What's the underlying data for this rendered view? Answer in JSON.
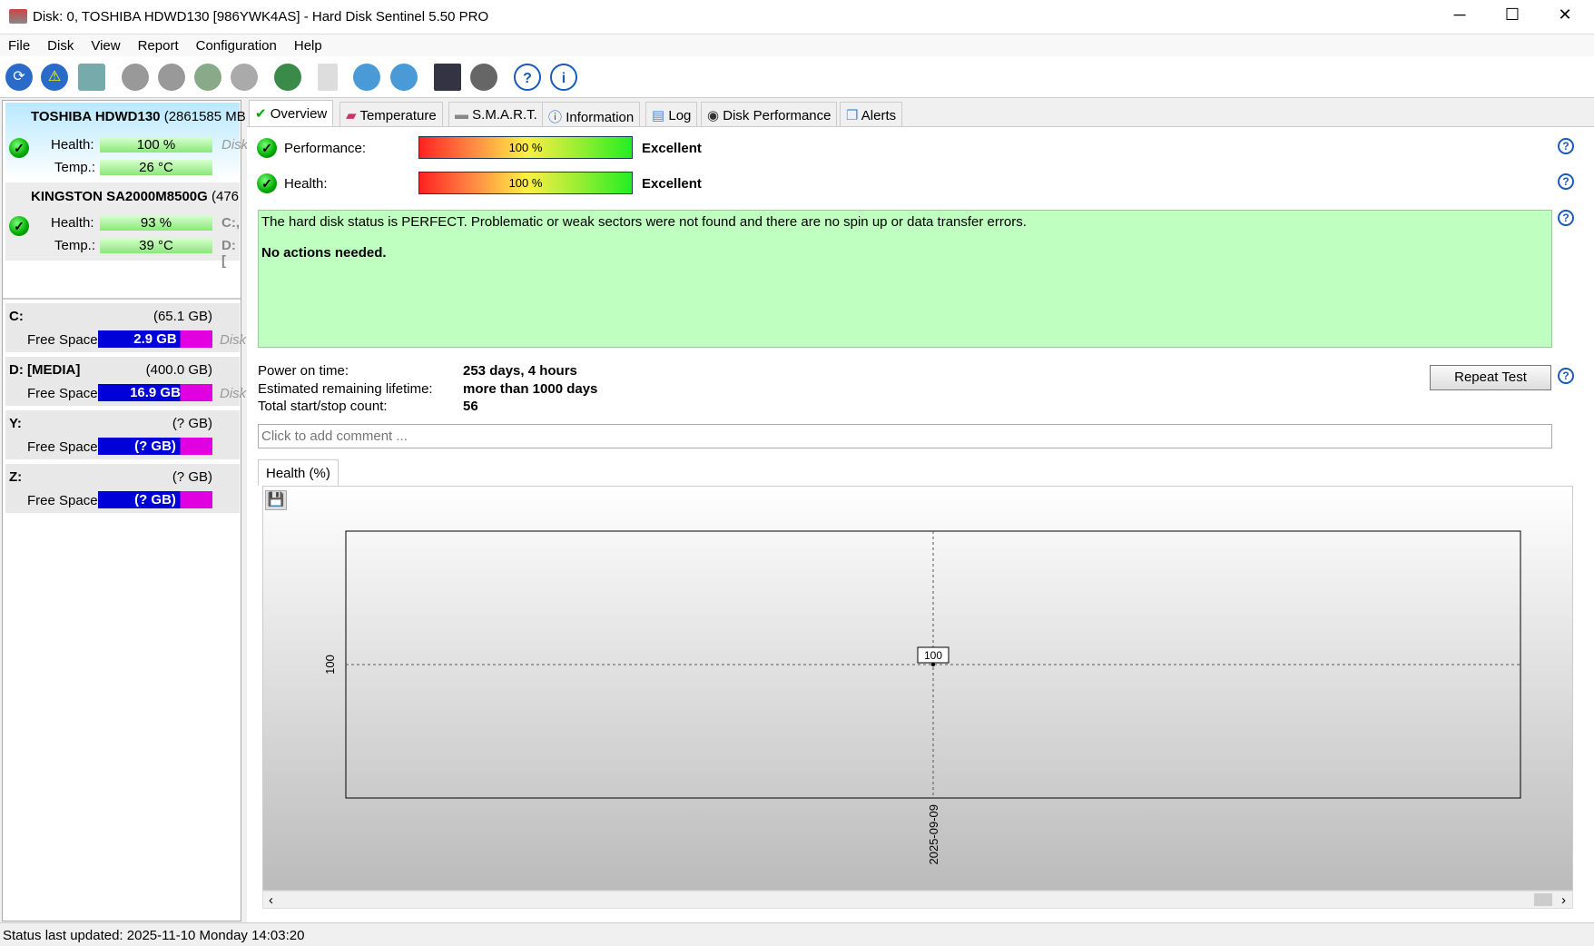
{
  "window": {
    "title": "Disk: 0, TOSHIBA HDWD130 [986YWK4AS]  -  Hard Disk Sentinel 5.50 PRO",
    "minimize": "─",
    "maximize": "☐",
    "close": "✕"
  },
  "menu": [
    "File",
    "Disk",
    "View",
    "Report",
    "Configuration",
    "Help"
  ],
  "toolbar": [
    "refresh-icon",
    "alert-icon",
    "disk-icon",
    "disk-tool-1-icon",
    "disk-tool-2-icon",
    "disk-check-icon",
    "disk-search-icon",
    "globe-icon",
    "report-icon",
    "sync-icon",
    "network-icon",
    "monitor-icon",
    "settings-icon",
    "help-icon",
    "info-icon"
  ],
  "disks": [
    {
      "name": "TOSHIBA HDWD130",
      "size": "(2861585 MB",
      "health_label": "Health:",
      "health": "100 %",
      "temp_label": "Temp.:",
      "temp": "26 °C",
      "side1": "Disk",
      "side2": ""
    },
    {
      "name": "KINGSTON SA2000M8500G",
      "size": "(476",
      "health_label": "Health:",
      "health": "93 %",
      "temp_label": "Temp.:",
      "temp": "39 °C",
      "side1": "C:,",
      "side2": "D: ["
    }
  ],
  "volumes": [
    {
      "letter": "C:",
      "size": "(65.1 GB)",
      "free_label": "Free Space",
      "free": "2.9 GB",
      "side": "Disk"
    },
    {
      "letter": "D: [MEDIA]",
      "size": "(400.0 GB)",
      "free_label": "Free Space",
      "free": "16.9 GB",
      "side": "Disk"
    },
    {
      "letter": "Y:",
      "size": "(? GB)",
      "free_label": "Free Space",
      "free": "(? GB)",
      "side": ""
    },
    {
      "letter": "Z:",
      "size": "(? GB)",
      "free_label": "Free Space",
      "free": "(? GB)",
      "side": ""
    }
  ],
  "tabs": [
    "Overview",
    "Temperature",
    "S.M.A.R.T.",
    "Information",
    "Log",
    "Disk Performance",
    "Alerts"
  ],
  "overview": {
    "performance_label": "Performance:",
    "performance": "100 %",
    "performance_percent": 100,
    "performance_rating": "Excellent",
    "health_label": "Health:",
    "health": "100 %",
    "health_percent": 100,
    "health_rating": "Excellent",
    "status_text": "The hard disk status is PERFECT. Problematic or weak sectors were not found and there are no spin up or data transfer errors.",
    "status_action": "No actions needed.",
    "power_on_label": "Power on time:",
    "power_on": "253 days, 4 hours",
    "lifetime_label": "Estimated remaining lifetime:",
    "lifetime": "more than 1000 days",
    "startstop_label": "Total start/stop count:",
    "startstop": "56",
    "repeat_test": "Repeat Test",
    "comment_placeholder": "Click to add comment ..."
  },
  "chart_tab": "Health (%)",
  "chart_data": {
    "type": "line",
    "x": [
      "2025-09-09"
    ],
    "values": [
      100
    ],
    "y_tick": "100",
    "x_tick": "2025-09-09",
    "point_label": "100"
  },
  "statusbar": "Status last updated: 2025-11-10 Monday 14:03:20"
}
